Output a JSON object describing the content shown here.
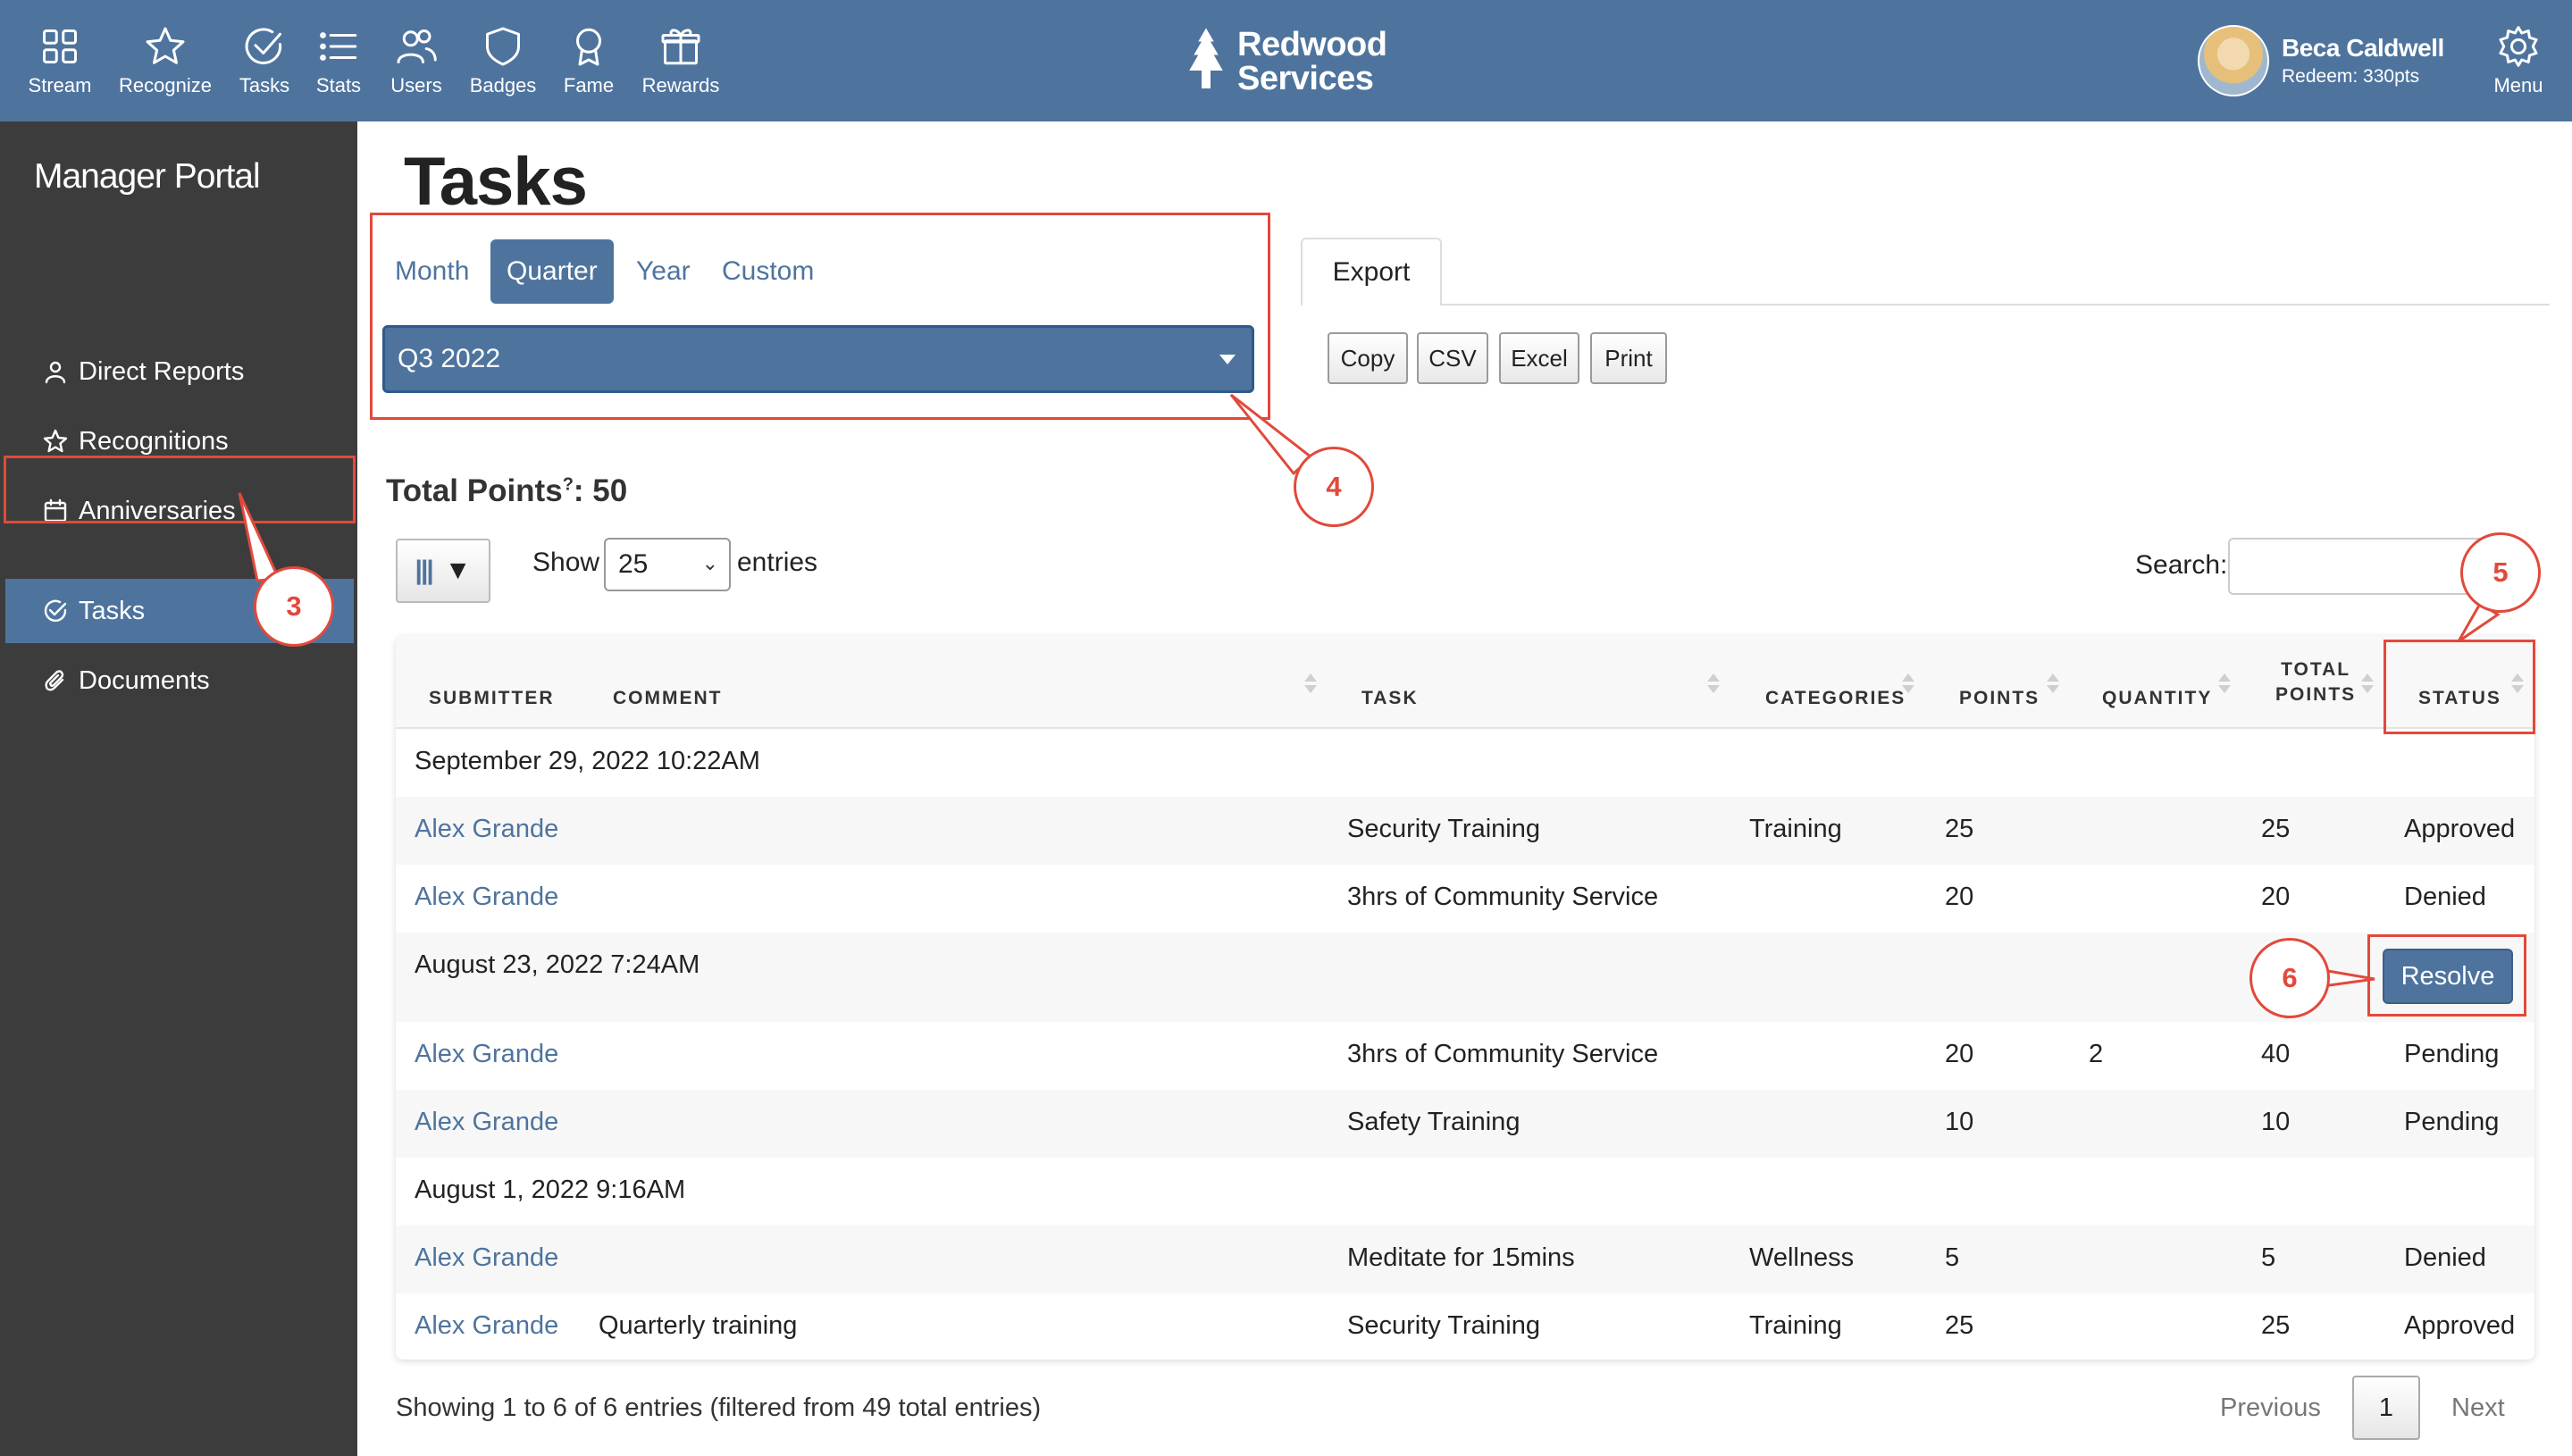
{
  "topbar": {
    "nav": [
      {
        "label": "Stream",
        "icon": "grid-icon"
      },
      {
        "label": "Recognize",
        "icon": "star-icon"
      },
      {
        "label": "Tasks",
        "icon": "check-circle-icon"
      },
      {
        "label": "Stats",
        "icon": "list-icon"
      },
      {
        "label": "Users",
        "icon": "users-icon"
      },
      {
        "label": "Badges",
        "icon": "shield-icon"
      },
      {
        "label": "Fame",
        "icon": "award-icon"
      },
      {
        "label": "Rewards",
        "icon": "gift-icon"
      }
    ],
    "brand_line1": "Redwood",
    "brand_line2": "Services",
    "user_name": "Beca Caldwell",
    "user_redeem": "Redeem: 330pts",
    "menu_label": "Menu",
    "bg_color": "#4e749e"
  },
  "sidebar": {
    "title": "Manager Portal",
    "items": [
      {
        "label": "Direct Reports",
        "icon": "user-icon"
      },
      {
        "label": "Recognitions",
        "icon": "star-icon"
      },
      {
        "label": "Anniversaries",
        "icon": "calendar-icon"
      },
      {
        "label": "Tasks",
        "icon": "check-circle-icon",
        "active": true
      },
      {
        "label": "Documents",
        "icon": "paperclip-icon"
      }
    ],
    "bg_color": "#3c3c3c"
  },
  "main": {
    "title": "Tasks",
    "period_tabs": [
      "Month",
      "Quarter",
      "Year",
      "Custom"
    ],
    "active_period": "Quarter",
    "period_value": "Q3 2022",
    "export_tab": "Export",
    "export_buttons": [
      "Copy",
      "CSV",
      "Excel",
      "Print"
    ],
    "total_points_label": "Total Points",
    "total_points_sup": "?",
    "total_points_value": ": 50",
    "column_toggle": "|||",
    "show_label": "Show",
    "entries_value": "25",
    "entries_label": "entries",
    "search_label": "Search:",
    "search_value": ""
  },
  "table": {
    "headers": {
      "submitter": "Submitter",
      "comment": "Comment",
      "task": "Task",
      "categories": "Categories",
      "points": "Points",
      "quantity": "Quantity",
      "total_points_1": "Total",
      "total_points_2": "Points",
      "status": "Status"
    },
    "groups": [
      {
        "date": "September 29, 2022 10:22AM",
        "rows": [
          {
            "submitter": "Alex Grande",
            "comment": "",
            "task": "Security Training",
            "category": "Training",
            "points": "25",
            "quantity": "",
            "total": "25",
            "status": "Approved"
          },
          {
            "submitter": "Alex Grande",
            "comment": "",
            "task": "3hrs of Community Service",
            "category": "",
            "points": "20",
            "quantity": "",
            "total": "20",
            "status": "Denied"
          }
        ]
      },
      {
        "date": "August 23, 2022 7:24AM",
        "action": "Resolve",
        "rows": [
          {
            "submitter": "Alex Grande",
            "comment": "",
            "task": "3hrs of Community Service",
            "category": "",
            "points": "20",
            "quantity": "2",
            "total": "40",
            "status": "Pending"
          },
          {
            "submitter": "Alex Grande",
            "comment": "",
            "task": "Safety Training",
            "category": "",
            "points": "10",
            "quantity": "",
            "total": "10",
            "status": "Pending"
          }
        ]
      },
      {
        "date": "August 1, 2022 9:16AM",
        "rows": [
          {
            "submitter": "Alex Grande",
            "comment": "",
            "task": "Meditate for 15mins",
            "category": "Wellness",
            "points": "5",
            "quantity": "",
            "total": "5",
            "status": "Denied"
          },
          {
            "submitter": "Alex Grande",
            "comment": "Quarterly training",
            "task": "Security Training",
            "category": "Training",
            "points": "25",
            "quantity": "",
            "total": "25",
            "status": "Approved"
          }
        ]
      }
    ],
    "footer_info": "Showing 1 to 6 of 6 entries (filtered from 49 total entries)",
    "previous_label": "Previous",
    "current_page": "1",
    "next_label": "Next"
  },
  "annotations": {
    "callouts": [
      "3",
      "4",
      "5",
      "6"
    ],
    "color": "#e2493b"
  }
}
